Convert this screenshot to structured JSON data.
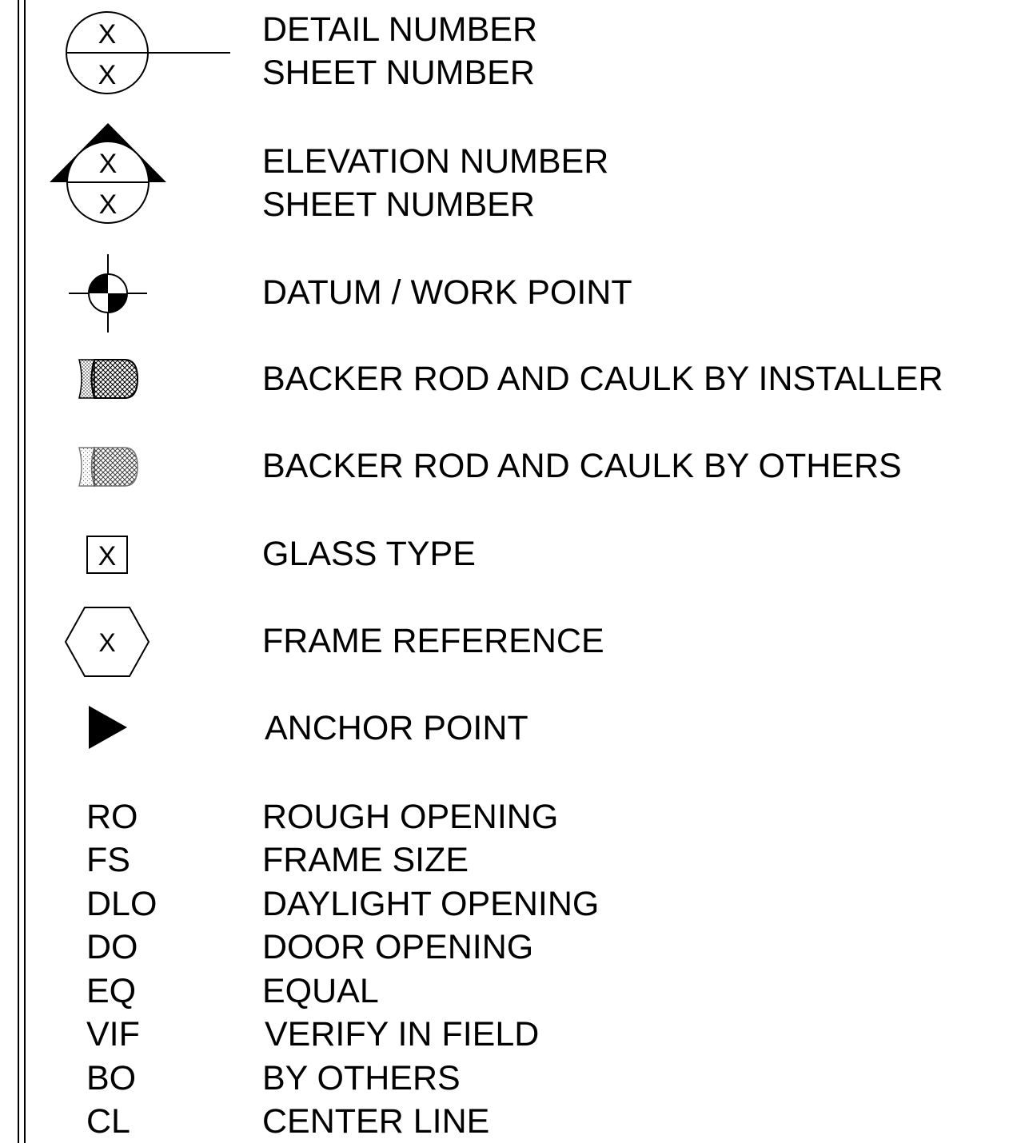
{
  "legend": {
    "detail": {
      "symbol_top": "X",
      "symbol_bottom": "X",
      "line1": "DETAIL NUMBER",
      "line2": "SHEET NUMBER"
    },
    "elevation": {
      "symbol_top": "X",
      "symbol_bottom": "X",
      "line1": "ELEVATION NUMBER",
      "line2": "SHEET NUMBER"
    },
    "datum": {
      "label": "DATUM / WORK POINT"
    },
    "backer_installer": {
      "label": "BACKER ROD AND CAULK BY INSTALLER"
    },
    "backer_others": {
      "label": "BACKER ROD AND CAULK BY OTHERS"
    },
    "glass_type": {
      "symbol": "X",
      "label": "GLASS TYPE"
    },
    "frame_reference": {
      "symbol": "X",
      "label": "FRAME REFERENCE"
    },
    "anchor_point": {
      "label": "ANCHOR POINT"
    }
  },
  "abbreviations": [
    {
      "abbr": "RO",
      "meaning": "ROUGH OPENING"
    },
    {
      "abbr": "FS",
      "meaning": "FRAME SIZE"
    },
    {
      "abbr": "DLO",
      "meaning": "DAYLIGHT OPENING"
    },
    {
      "abbr": "DO",
      "meaning": "DOOR OPENING"
    },
    {
      "abbr": "EQ",
      "meaning": "EQUAL"
    },
    {
      "abbr": "VIF",
      "meaning": "VERIFY IN FIELD"
    },
    {
      "abbr": "BO",
      "meaning": "BY OTHERS"
    },
    {
      "abbr": "CL",
      "meaning": "CENTER LINE"
    }
  ],
  "icons": {
    "detail": "detail-callout-icon",
    "elevation": "elevation-marker-icon",
    "datum": "datum-point-icon",
    "backer_installer": "backer-rod-caulk-installer-icon",
    "backer_others": "backer-rod-caulk-others-icon",
    "glass_type": "glass-type-tag-icon",
    "frame_reference": "frame-reference-hexagon-icon",
    "anchor_point": "anchor-point-triangle-icon"
  },
  "colors": {
    "ink": "#000000",
    "paper": "#ffffff"
  }
}
